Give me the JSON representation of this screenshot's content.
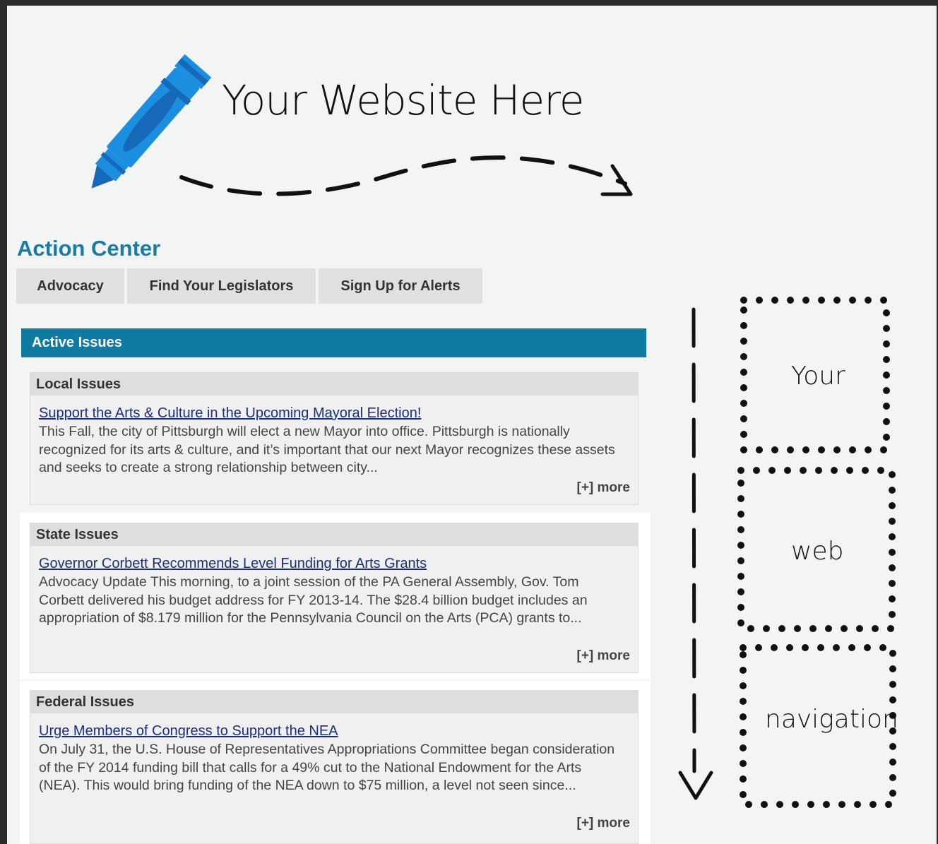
{
  "header": {
    "site_title": "Your Website Here"
  },
  "action_center": {
    "title": "Action Center",
    "tabs": [
      {
        "label": "Advocacy"
      },
      {
        "label": "Find Your Legislators"
      },
      {
        "label": "Sign Up for Alerts"
      }
    ]
  },
  "active_issues": {
    "title": "Active Issues",
    "panels": [
      {
        "heading": "Local Issues",
        "link": "Support the Arts & Culture in the Upcoming Mayoral Election!",
        "text": "This Fall, the city of Pittsburgh will elect a new Mayor into office.  Pittsburgh is nationally recognized for its arts & culture, and it’s important that our next Mayor recognizes these assets and seeks to create a strong relationship between city...",
        "more": "[+] more"
      },
      {
        "heading": "State Issues",
        "link": "Governor Corbett Recommends Level Funding for Arts Grants",
        "text": "Advocacy Update This morning, to a joint session of the PA General Assembly, Gov. Tom Corbett delivered his budget address for FY 2013-14.  The $28.4 billion budget includes an appropriation of $8.179 million for the Pennsylvania Council on the Arts (PCA) grants to...",
        "more": "[+] more"
      },
      {
        "heading": "Federal Issues",
        "link": "Urge Members of Congress to Support the NEA",
        "text": "On July 31, the U.S. House of Representatives Appropriations Committee began consideration of the FY 2014 funding bill that calls for a 49% cut to the National Endowment for the Arts (NEA). This would bring funding of the NEA down to $75 million, a level not seen since...",
        "more": "[+] more"
      }
    ]
  },
  "navigation_placeholder": {
    "boxes": [
      {
        "label": "Your"
      },
      {
        "label": "web"
      },
      {
        "label": "navigation"
      }
    ]
  },
  "colors": {
    "accent": "#117aa3",
    "title": "#1a7ba6",
    "link": "#1a2f7c",
    "crayon": "#1b8ee0"
  }
}
